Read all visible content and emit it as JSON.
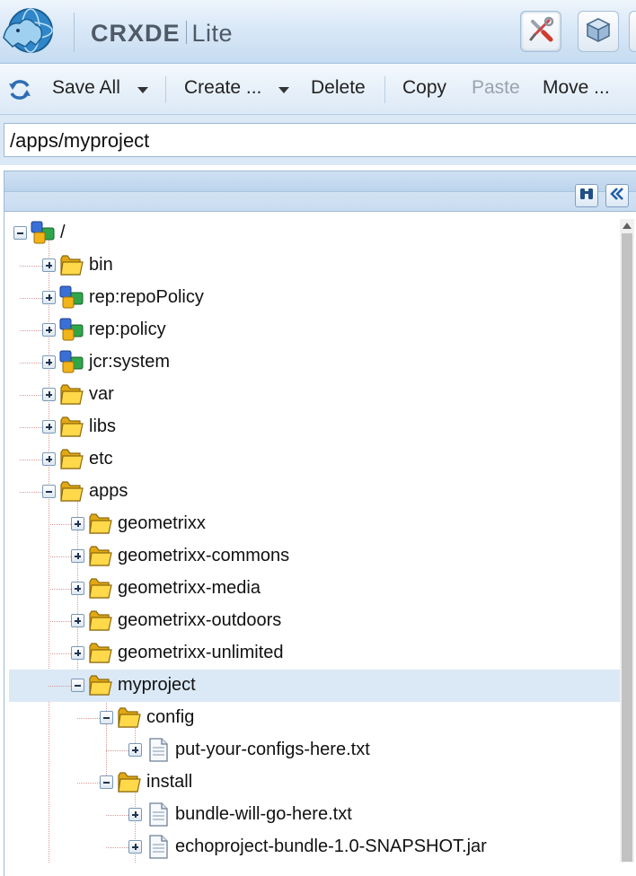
{
  "header": {
    "brand_bold": "CRXDE",
    "brand_light": "Lite",
    "buttons": [
      {
        "name": "tools",
        "icon": "wrench-screwdriver-icon",
        "active": true
      },
      {
        "name": "packages",
        "icon": "package-cube-icon",
        "active": false
      }
    ]
  },
  "toolbar": {
    "refresh_icon": "refresh-icon",
    "save_all": "Save All",
    "create": "Create ...",
    "delete": "Delete",
    "copy": "Copy",
    "paste": "Paste",
    "move": "Move ..."
  },
  "path": {
    "value": "/apps/myproject"
  },
  "panel": {
    "tools": [
      {
        "name": "find",
        "icon": "binoculars-icon"
      },
      {
        "name": "collapse",
        "icon": "double-chevron-left-icon"
      }
    ]
  },
  "tree": [
    {
      "label": "/",
      "level": 0,
      "expanded": true,
      "icon": "node-icon"
    },
    {
      "label": "bin",
      "level": 1,
      "expanded": false,
      "icon": "folder-icon"
    },
    {
      "label": "rep:repoPolicy",
      "level": 1,
      "expanded": false,
      "icon": "node-icon"
    },
    {
      "label": "rep:policy",
      "level": 1,
      "expanded": false,
      "icon": "node-icon"
    },
    {
      "label": "jcr:system",
      "level": 1,
      "expanded": false,
      "icon": "node-icon"
    },
    {
      "label": "var",
      "level": 1,
      "expanded": false,
      "icon": "folder-icon"
    },
    {
      "label": "libs",
      "level": 1,
      "expanded": false,
      "icon": "folder-icon"
    },
    {
      "label": "etc",
      "level": 1,
      "expanded": false,
      "icon": "folder-icon"
    },
    {
      "label": "apps",
      "level": 1,
      "expanded": true,
      "icon": "folder-icon"
    },
    {
      "label": "geometrixx",
      "level": 2,
      "expanded": false,
      "icon": "folder-icon"
    },
    {
      "label": "geometrixx-commons",
      "level": 2,
      "expanded": false,
      "icon": "folder-icon"
    },
    {
      "label": "geometrixx-media",
      "level": 2,
      "expanded": false,
      "icon": "folder-icon"
    },
    {
      "label": "geometrixx-outdoors",
      "level": 2,
      "expanded": false,
      "icon": "folder-icon"
    },
    {
      "label": "geometrixx-unlimited",
      "level": 2,
      "expanded": false,
      "icon": "folder-icon"
    },
    {
      "label": "myproject",
      "level": 2,
      "expanded": true,
      "icon": "folder-icon",
      "selected": true
    },
    {
      "label": "config",
      "level": 3,
      "expanded": true,
      "icon": "folder-icon"
    },
    {
      "label": "put-your-configs-here.txt",
      "level": 4,
      "expanded": false,
      "icon": "file-icon"
    },
    {
      "label": "install",
      "level": 3,
      "expanded": true,
      "icon": "folder-icon"
    },
    {
      "label": "bundle-will-go-here.txt",
      "level": 4,
      "expanded": false,
      "icon": "file-icon"
    },
    {
      "label": "echoproject-bundle-1.0-SNAPSHOT.jar",
      "level": 4,
      "expanded": false,
      "icon": "file-icon"
    }
  ],
  "colors": {
    "accent": "#c6dcf1",
    "selected_row": "#dbe8f5",
    "folder": "#f2c232"
  }
}
